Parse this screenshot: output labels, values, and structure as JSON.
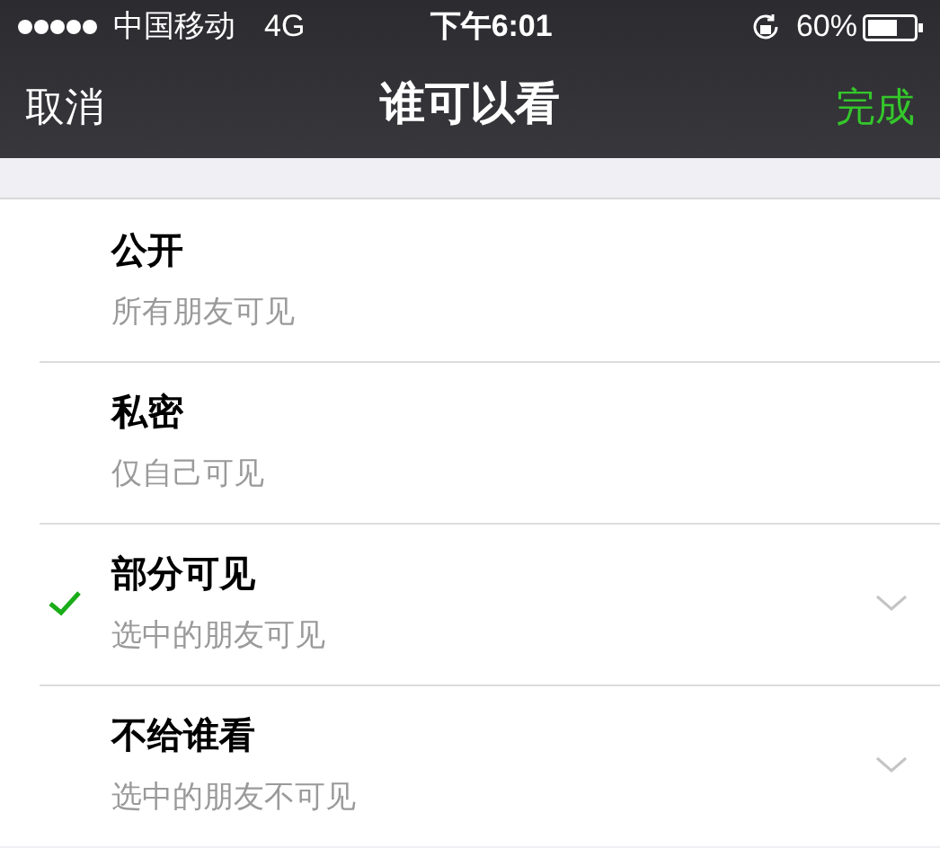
{
  "status_bar": {
    "carrier": "中国移动",
    "network": "4G",
    "time": "下午6:01",
    "battery": "60%"
  },
  "nav": {
    "cancel": "取消",
    "title": "谁可以看",
    "done": "完成"
  },
  "options": [
    {
      "title": "公开",
      "subtitle": "所有朋友可见",
      "selected": false,
      "expandable": false
    },
    {
      "title": "私密",
      "subtitle": "仅自己可见",
      "selected": false,
      "expandable": false
    },
    {
      "title": "部分可见",
      "subtitle": "选中的朋友可见",
      "selected": true,
      "expandable": true
    },
    {
      "title": "不给谁看",
      "subtitle": "选中的朋友不可见",
      "selected": false,
      "expandable": true
    }
  ]
}
